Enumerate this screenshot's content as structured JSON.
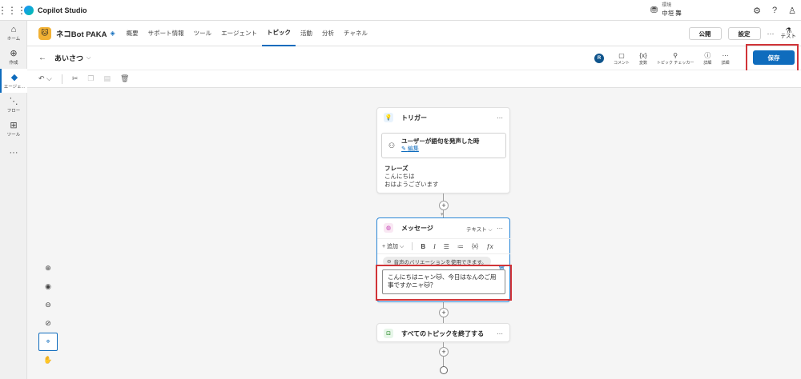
{
  "app": {
    "title": "Copilot Studio"
  },
  "environment": {
    "label": "環境",
    "name": "中垣 舞"
  },
  "rail": [
    {
      "label": "ホーム",
      "icon": "home-icon",
      "glyph": "⌂"
    },
    {
      "label": "作成",
      "icon": "create-icon",
      "glyph": "⊕"
    },
    {
      "label": "エージェ...",
      "icon": "agent-icon",
      "glyph": "◆"
    },
    {
      "label": "フロー",
      "icon": "flow-icon",
      "glyph": "⋱"
    },
    {
      "label": "ツール",
      "icon": "tool-icon",
      "glyph": "⊞"
    }
  ],
  "agent": {
    "name": "ネコBot PAKA",
    "tabs": [
      "概要",
      "サポート情報",
      "ツール",
      "エージェント",
      "トピック",
      "活動",
      "分析",
      "チャネル"
    ],
    "active_tab": "トピック",
    "publish_label": "公開",
    "settings_label": "設定",
    "test_label": "テスト"
  },
  "topic": {
    "title": "あいさつ",
    "tools": [
      {
        "label": "コメント",
        "icon": "comment-icon",
        "glyph": "▢"
      },
      {
        "label": "変数",
        "icon": "variable-icon",
        "glyph": "{x}"
      },
      {
        "label": "トピック チェッカー",
        "icon": "checker-icon",
        "glyph": "⚲"
      },
      {
        "label": "詳細",
        "icon": "info-icon",
        "glyph": "ⓘ"
      },
      {
        "label": "詳細",
        "icon": "more-icon",
        "glyph": "⋯"
      }
    ],
    "user_initial": "R",
    "save_label": "保存"
  },
  "trigger_node": {
    "title": "トリガー",
    "trigger_title": "ユーザーが語句を発声した時",
    "edit_label": "編集",
    "phrases_label": "フレーズ",
    "phrases": [
      "こんにちは",
      "おはようございます"
    ]
  },
  "message_node": {
    "title": "メッセージ",
    "type": "テキスト",
    "add_label": "追加",
    "variation_text": "音声のバリエーションを使用できます。",
    "text": "こんにちはニャン🐱、今日はなんのご用事ですかニャ🐱？"
  },
  "end_node": {
    "title": "すべてのトピックを終了する"
  },
  "colors": {
    "accent": "#0f6cbd",
    "highlight": "#d13438"
  }
}
